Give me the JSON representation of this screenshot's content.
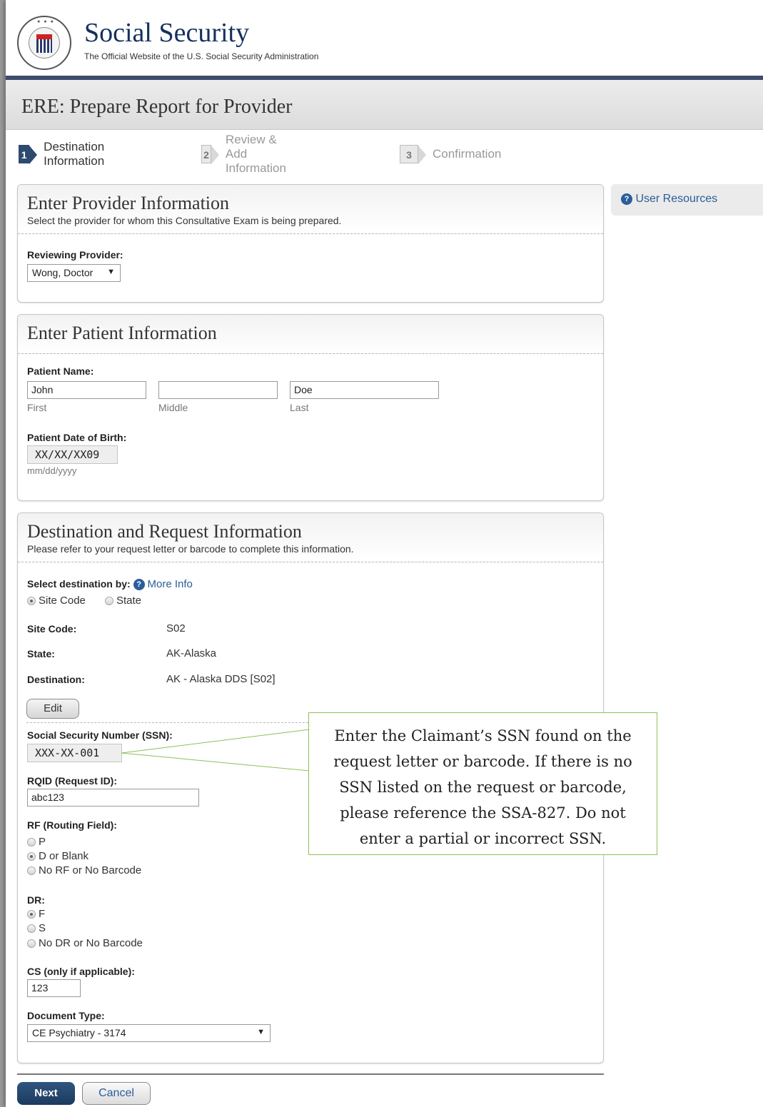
{
  "header": {
    "brand_title": "Social Security",
    "brand_subtitle": "The Official Website of the U.S. Social Security Administration",
    "seal_icon": "ssa-seal-icon"
  },
  "page_title": "ERE: Prepare Report for Provider",
  "steps": [
    {
      "number": "1",
      "label": "Destination Information",
      "active": true
    },
    {
      "number": "2",
      "label": "Review & Add Information",
      "active": false
    },
    {
      "number": "3",
      "label": "Confirmation",
      "active": false
    }
  ],
  "sidebar": {
    "user_resources": "User Resources"
  },
  "provider_panel": {
    "title": "Enter Provider Information",
    "subtitle": "Select the provider for whom this Consultative Exam is being prepared.",
    "reviewing_provider_label": "Reviewing Provider:",
    "reviewing_provider_value": "Wong, Doctor"
  },
  "patient_panel": {
    "title": "Enter Patient Information",
    "name_label": "Patient Name:",
    "first_value": "John",
    "middle_value": "",
    "last_value": "Doe",
    "first_hint": "First",
    "middle_hint": "Middle",
    "last_hint": "Last",
    "dob_label": "Patient Date of Birth:",
    "dob_value": "XX/XX/XX09",
    "dob_hint": "mm/dd/yyyy"
  },
  "destination_panel": {
    "title": "Destination and Request Information",
    "subtitle": "Please refer to your request letter or barcode to complete this information.",
    "select_by_label": "Select destination by:",
    "more_info": "More Info",
    "option_site_code": "Site Code",
    "option_state": "State",
    "site_code_label": "Site Code:",
    "site_code_value": "S02",
    "state_label": "State:",
    "state_value": "AK-Alaska",
    "destination_label": "Destination:",
    "destination_value": "AK - Alaska DDS [S02]",
    "edit_button": "Edit",
    "ssn_label": "Social Security Number (SSN):",
    "ssn_value": "XXX-XX-001",
    "rqid_label": "RQID (Request ID):",
    "rqid_value": "abc123",
    "rf_label": "RF (Routing Field):",
    "rf_options": [
      "P",
      "D or Blank",
      "No RF or No Barcode"
    ],
    "rf_selected": "D or Blank",
    "dr_label": "DR:",
    "dr_options": [
      "F",
      "S",
      "No DR or No Barcode"
    ],
    "dr_selected": "F",
    "cs_label": "CS (only if applicable):",
    "cs_value": "123",
    "doc_type_label": "Document Type:",
    "doc_type_value": "CE Psychiatry - 3174"
  },
  "callout": {
    "text": "Enter the Claimant’s SSN found on the request letter or barcode.  If there is no SSN listed on the request or barcode, please reference the SSA-827.  Do not enter a partial or incorrect SSN."
  },
  "footer": {
    "next_button": "Next",
    "cancel_button": "Cancel"
  },
  "colors": {
    "navy": "#2e4a6e",
    "link_blue": "#2a5d9a",
    "callout_border": "#8fbf5a"
  }
}
